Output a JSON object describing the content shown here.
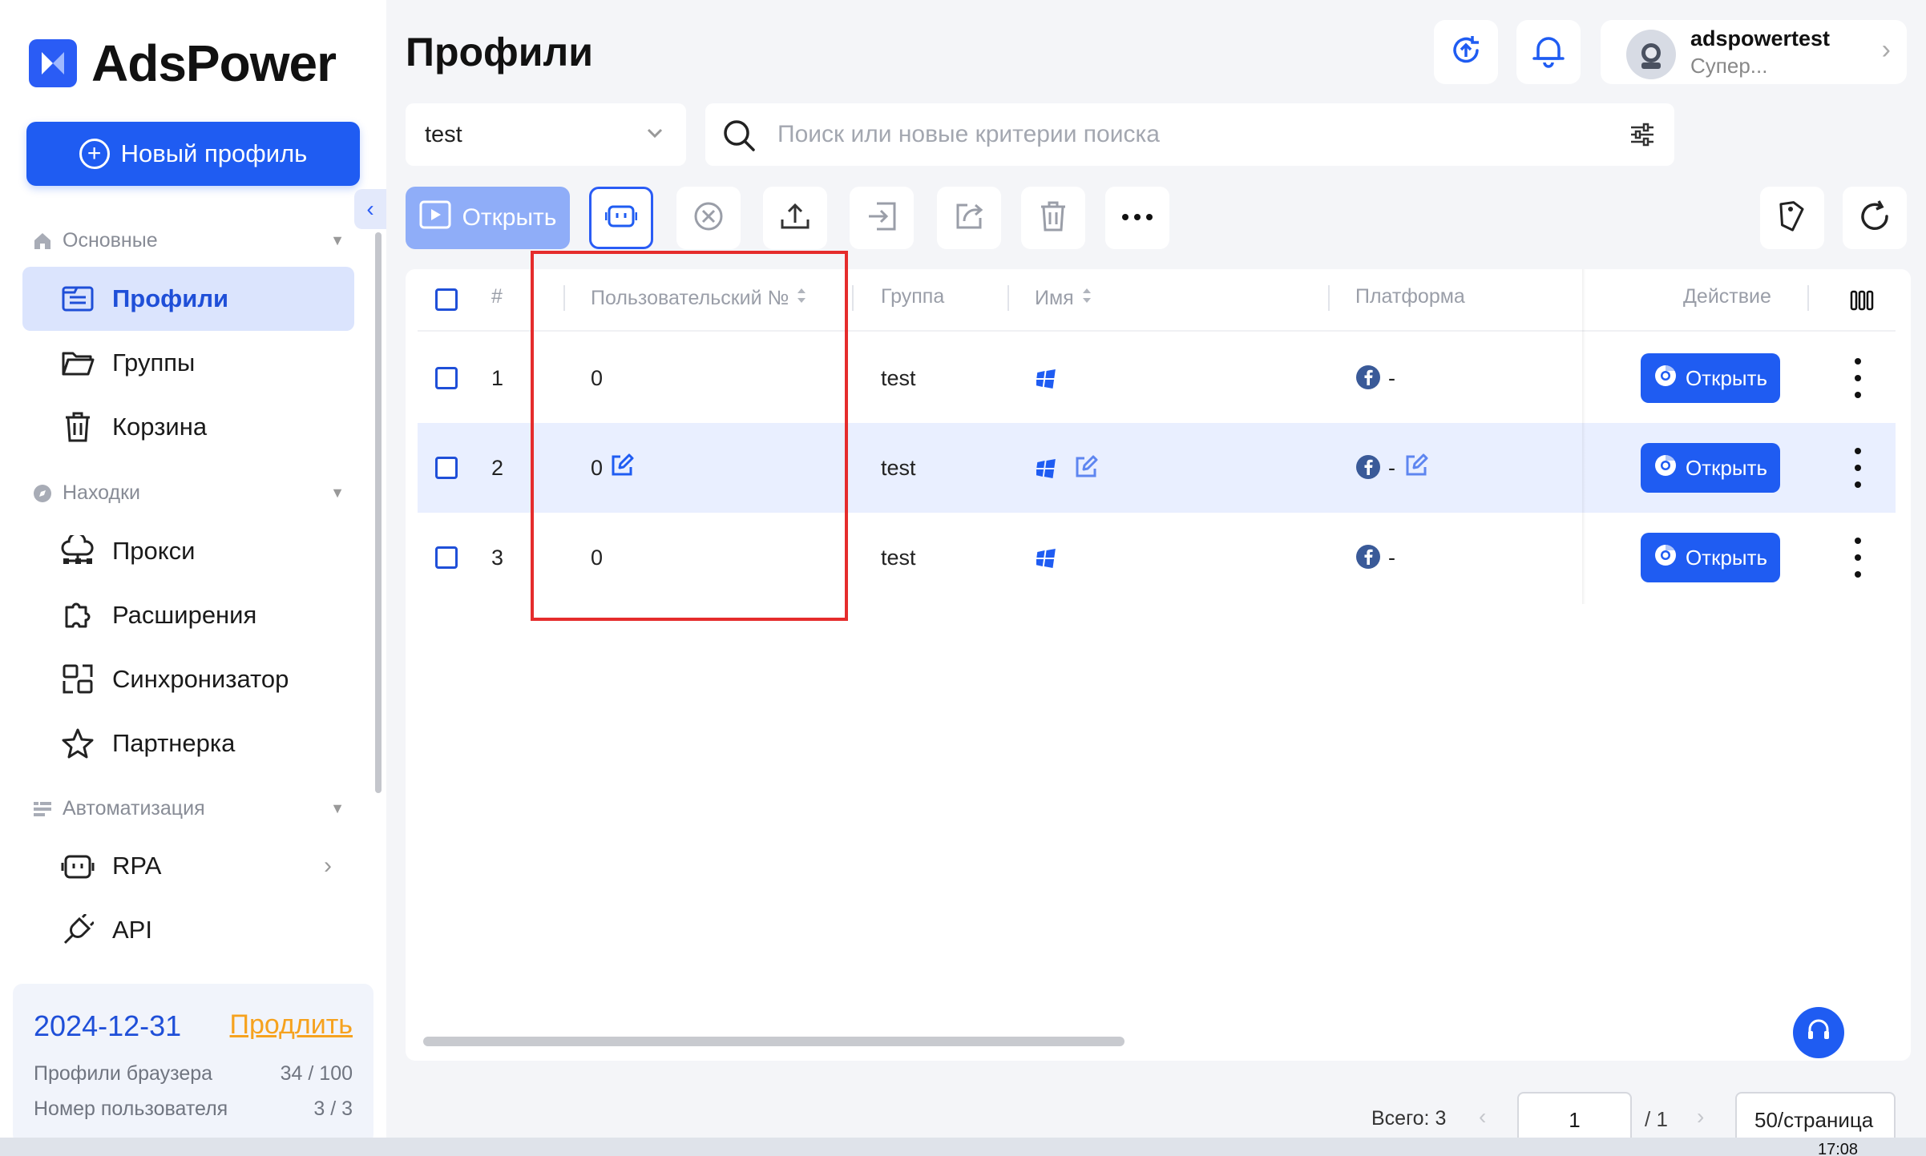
{
  "app": {
    "name": "AdsPower"
  },
  "sidebar": {
    "new_profile": "Новый профиль",
    "sections": [
      {
        "label": "Основные"
      },
      {
        "label": "Находки"
      },
      {
        "label": "Автоматизация"
      }
    ],
    "items": [
      {
        "label": "Профили",
        "active": true
      },
      {
        "label": "Группы"
      },
      {
        "label": "Корзина"
      },
      {
        "label": "Прокси"
      },
      {
        "label": "Расширения"
      },
      {
        "label": "Синхронизатор"
      },
      {
        "label": "Партнерка"
      },
      {
        "label": "RPA"
      },
      {
        "label": "API"
      }
    ],
    "plan": {
      "expiry": "2024-12-31",
      "renew": "Продлить",
      "browser_profiles_label": "Профили браузера",
      "browser_profiles_value": "34 / 100",
      "users_label": "Номер пользователя",
      "users_value": "3 / 3"
    }
  },
  "header": {
    "title": "Профили",
    "user": {
      "name": "adspowertest",
      "role": "Супер..."
    }
  },
  "filters": {
    "group": "test",
    "search_placeholder": "Поиск или новые критерии поиска"
  },
  "toolbar": {
    "open": "Открыть"
  },
  "table": {
    "columns": {
      "num": "#",
      "user_no": "Пользовательский №",
      "group": "Группа",
      "name": "Имя",
      "platform": "Платформа",
      "action": "Действие"
    },
    "rows": [
      {
        "num": "1",
        "user_no": "0",
        "group": "test",
        "platform": "-",
        "action": "Открыть"
      },
      {
        "num": "2",
        "user_no": "0",
        "group": "test",
        "platform": "-",
        "action": "Открыть"
      },
      {
        "num": "3",
        "user_no": "0",
        "group": "test",
        "platform": "-",
        "action": "Открыть"
      }
    ]
  },
  "footer": {
    "total": "Всего: 3",
    "page": "1",
    "page_total": "/ 1",
    "per_page": "50/страница"
  },
  "taskbar": {
    "clock": "17:08"
  },
  "colors": {
    "accent": "#1f5cf2",
    "highlight": "#e52c2c",
    "renew": "#f6a21e"
  }
}
